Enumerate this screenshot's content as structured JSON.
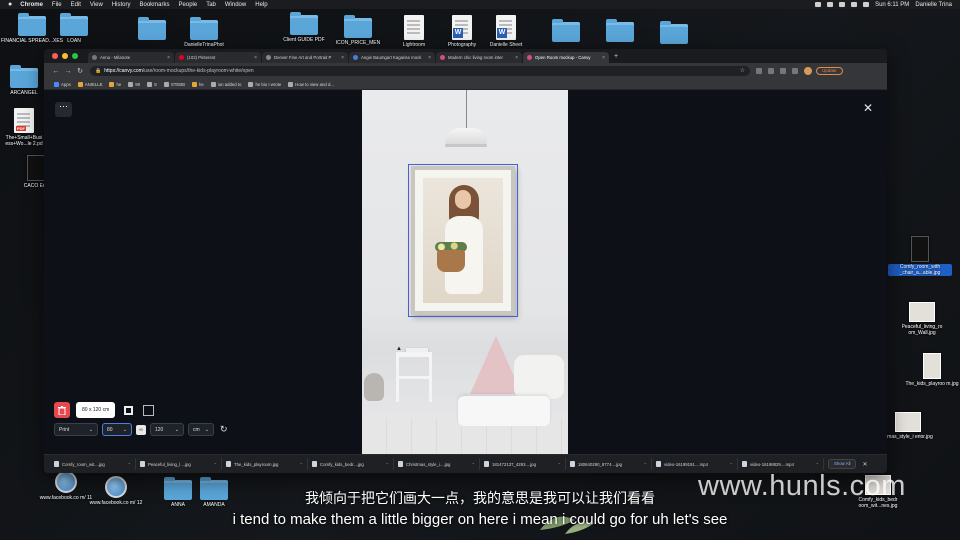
{
  "menubar": {
    "items": [
      "Chrome",
      "File",
      "Edit",
      "View",
      "History",
      "Bookmarks",
      "People",
      "Tab",
      "Window",
      "Help"
    ],
    "clock": "Sun 6:11 PM",
    "user": "Danielle Trina"
  },
  "desktop_icons": [
    {
      "label": "FINANCIAL SPREAD...XES",
      "type": "folder"
    },
    {
      "label": "LOAN",
      "type": "folder"
    },
    {
      "label": "DanielleTrinaPhot",
      "type": "folder"
    },
    {
      "label": "Client GUIDE PDF",
      "type": "folder"
    },
    {
      "label": "ICON_PRICE_MEN",
      "type": "folder"
    },
    {
      "label": "Lightroom",
      "type": "doc"
    },
    {
      "label": "Photography",
      "type": "word"
    },
    {
      "label": "Danielle Sheet",
      "type": "word"
    },
    {
      "label": "ARCANGEL",
      "type": "folder"
    },
    {
      "label": "The+Small+Busi ess+Wo...le 2.pd",
      "type": "pdf"
    },
    {
      "label": "CACO Edit",
      "type": "black"
    },
    {
      "label": "Comfy_room_with _chair_a...able.jpg",
      "type": "img"
    },
    {
      "label": "Peaceful_living_ro om_Wall.jpg",
      "type": "img"
    },
    {
      "label": "The_kids_playroo m.jpg",
      "type": "img"
    },
    {
      "label": "stmas_style_i erior.jpg",
      "type": "img"
    },
    {
      "label": "Comfy_kids_bedr oom_wit...nes.jpg",
      "type": "img"
    },
    {
      "label": "www.facebook.co m/ 11",
      "type": "globe"
    },
    {
      "label": "www.facebook.co m/ 12",
      "type": "globe"
    },
    {
      "label": "ANNA",
      "type": "folder"
    },
    {
      "label": "AMANDA",
      "type": "folder"
    }
  ],
  "tabs": [
    {
      "label": "Anna - Milanote",
      "color": "#555"
    },
    {
      "label": "(102) Pinterest",
      "color": "#e60023"
    },
    {
      "label": "Denver Fine Art and Portrait P",
      "color": "#888"
    },
    {
      "label": "Angie Baumgart Kagarise mock",
      "color": "#4a7fd4"
    },
    {
      "label": "Modern chic living room inter",
      "color": "#d64f7a"
    },
    {
      "label": "Open Room mockup - Canvy",
      "color": "#d64f7a",
      "active": true
    }
  ],
  "address": {
    "host": "https://canvy.com",
    "path": "/use/room-mockups/the-kids-playroom-white/open"
  },
  "update_label": "Update",
  "bookmarks": [
    "Apps",
    "ANIELLE",
    "he",
    "99",
    "S",
    "STEBB",
    "he",
    "ion added to",
    "he bio I wrote",
    "How to view and d..."
  ],
  "editor": {
    "size_badge": "80 x 120 cm",
    "print_label": "Print",
    "width_value": "80",
    "height_value": "120",
    "unit_label": "cm"
  },
  "downloads": [
    "Comfy_room_wit....jpg",
    "Peaceful_living_l....jpg",
    "The_kids_playroom.jpg",
    "Comfy_kids_bedr....jpg",
    "Christmas_style_i....jpg",
    "181472137_4293....jpg",
    "180640290_8774....jpg",
    "video-16199191....mp4",
    "video-16198829....mp4"
  ],
  "show_all": "Show All",
  "watermark": "www.hunls.com",
  "subtitle_cn": "我倾向于把它们画大一点，我的意思是我可以让我们看看",
  "subtitle_en": "i tend to make them a little bigger on here i mean i could go for uh let's see"
}
